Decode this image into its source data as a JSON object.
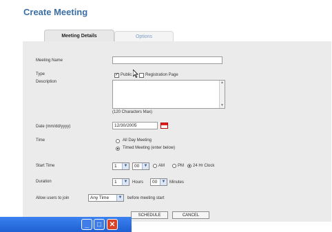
{
  "page_title": "Create Meeting",
  "tabs": [
    {
      "label": "Meeting Details",
      "active": true
    },
    {
      "label": "Options",
      "active": false
    }
  ],
  "form": {
    "meeting_name_label": "Meeting Name",
    "meeting_name_value": "",
    "type_label": "Type",
    "public_label": "Public",
    "public_checked": true,
    "registration_label": "Registration Page",
    "registration_checked": false,
    "description_label": "Description",
    "description_value": "",
    "char_limit_note": "(120 Characters Max)",
    "date_label": "Date (mm/dd/yyyy)",
    "date_value": "12/30/2005",
    "time_label": "Time",
    "all_day_label": "All Day Meeting",
    "timed_label": "Timed Meeting (enter below)",
    "start_time_label": "Start Time",
    "start_hour": "1",
    "start_minute": "00",
    "am_label": "AM",
    "pm_label": "PM",
    "clock24_label": "24 Hr Clock",
    "duration_label": "Duration",
    "duration_hours": "1",
    "hours_label": "Hours",
    "duration_minutes": "00",
    "minutes_label": "Minutes",
    "allow_users_label": "Allow users to join",
    "allow_users_value": "Any Time",
    "before_start_label": "before meeting start"
  },
  "buttons": {
    "schedule": "SCHEDULE",
    "cancel": "CANCEL"
  },
  "window_controls": {
    "minimize": "_",
    "maximize": "□",
    "close": "✕"
  }
}
